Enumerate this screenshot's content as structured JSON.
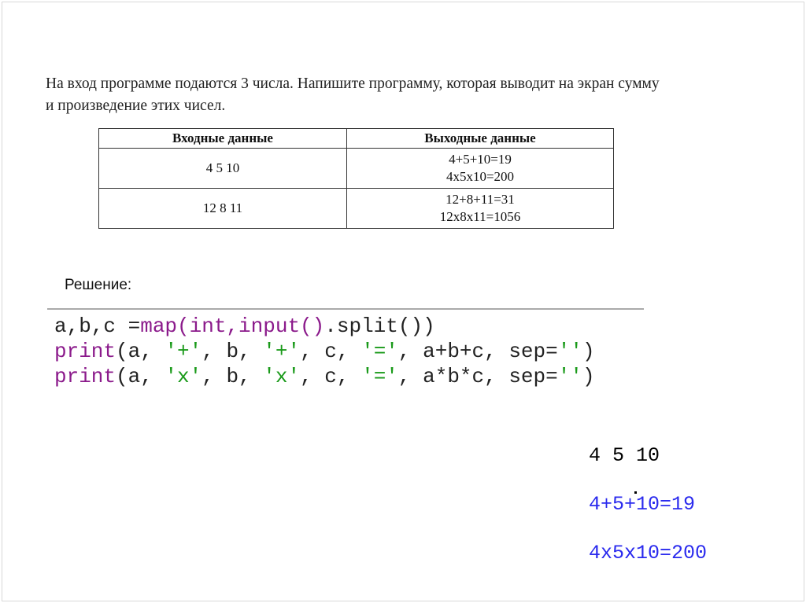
{
  "task": {
    "line1": "На вход программе подаются 3 числа. Напишите программу, которая выводит на экран сумму",
    "line2": "и произведение этих чисел."
  },
  "table": {
    "headers": [
      "Входные данные",
      "Выходные данные"
    ],
    "rows": [
      {
        "input": "4 5 10",
        "output": [
          "4+5+10=19",
          "4x5x10=200"
        ]
      },
      {
        "input": "12 8 11",
        "output": [
          "12+8+11=31",
          "12x8x11=1056"
        ]
      }
    ]
  },
  "solution_label": "Решение:",
  "code": {
    "l1": {
      "a": "a,b,c =",
      "b": "map(int,input()",
      "c": ".split())"
    },
    "l2": {
      "p": "print",
      "a": "(a, ",
      "s1": "'+'",
      "b": ", b, ",
      "s2": "'+'",
      "c": ", c, ",
      "s3": "'='",
      "d": ", a+b+c, sep=",
      "s4": "''",
      "e": ")"
    },
    "l3": {
      "p": "print",
      "a": "(a, ",
      "s1": "'x'",
      "b": ", b, ",
      "s2": "'x'",
      "c": ", c, ",
      "s3": "'='",
      "d": ", a*b*c, sep=",
      "s4": "''",
      "e": ")"
    }
  },
  "output": {
    "input_line": "4 5 10",
    "sum_line": "4+5+10=19",
    "product_line": "4x5x10=200"
  }
}
